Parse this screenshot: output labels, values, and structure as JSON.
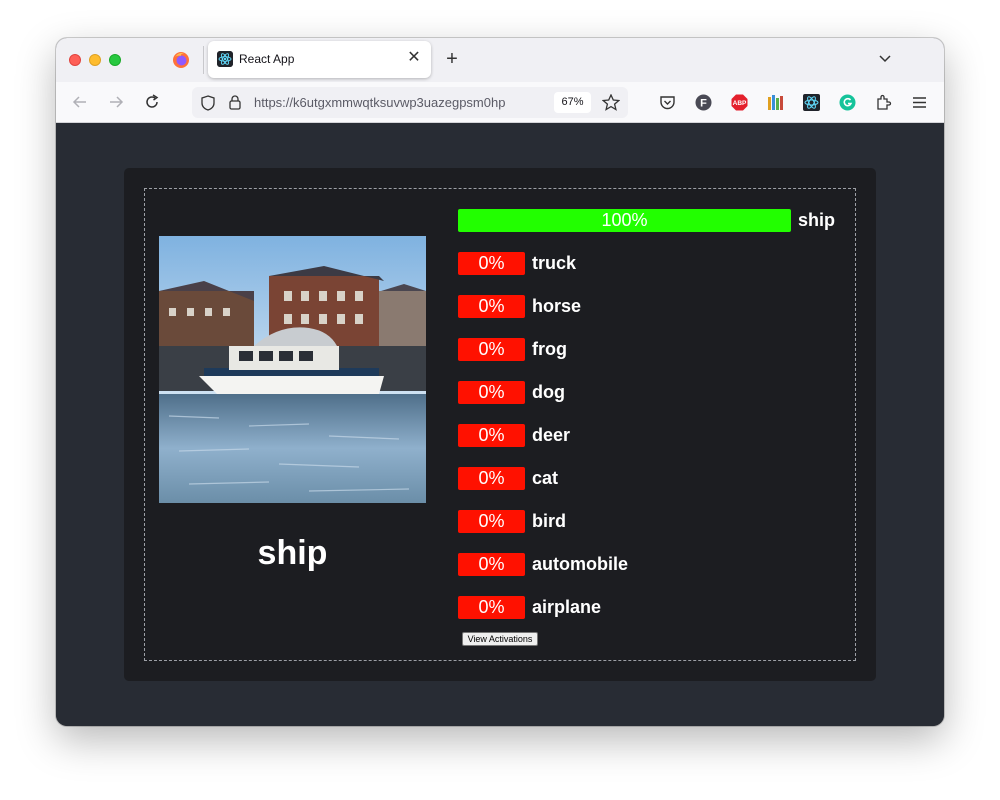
{
  "browser": {
    "tab_title": "React App",
    "url": "https://k6utgxmmwqtksuvwp3uazegpsm0hp",
    "zoom": "67%"
  },
  "icons": [
    "firefox-icon",
    "react-icon",
    "close-icon",
    "plus-icon",
    "chevron-down-icon",
    "back-arrow-icon",
    "forward-arrow-icon",
    "reload-icon",
    "shield-icon",
    "lock-icon",
    "star-icon",
    "pocket-icon",
    "f-extension-icon",
    "adblock-icon",
    "library-icon",
    "react-devtools-icon",
    "grammarly-icon",
    "extensions-icon",
    "menu-icon"
  ],
  "app": {
    "prediction": "ship",
    "view_activations_label": "View Activations",
    "predictions": [
      {
        "label": "ship",
        "percent_text": "100%",
        "value": 1.0,
        "color": "#22ff00"
      },
      {
        "label": "truck",
        "percent_text": "0%",
        "value": 0.0,
        "color": "#ff1100"
      },
      {
        "label": "horse",
        "percent_text": "0%",
        "value": 0.0,
        "color": "#ff1100"
      },
      {
        "label": "frog",
        "percent_text": "0%",
        "value": 0.0,
        "color": "#ff1100"
      },
      {
        "label": "dog",
        "percent_text": "0%",
        "value": 0.0,
        "color": "#ff1100"
      },
      {
        "label": "deer",
        "percent_text": "0%",
        "value": 0.0,
        "color": "#ff1100"
      },
      {
        "label": "cat",
        "percent_text": "0%",
        "value": 0.0,
        "color": "#ff1100"
      },
      {
        "label": "bird",
        "percent_text": "0%",
        "value": 0.0,
        "color": "#ff1100"
      },
      {
        "label": "automobile",
        "percent_text": "0%",
        "value": 0.0,
        "color": "#ff1100"
      },
      {
        "label": "airplane",
        "percent_text": "0%",
        "value": 0.0,
        "color": "#ff1100"
      }
    ]
  }
}
